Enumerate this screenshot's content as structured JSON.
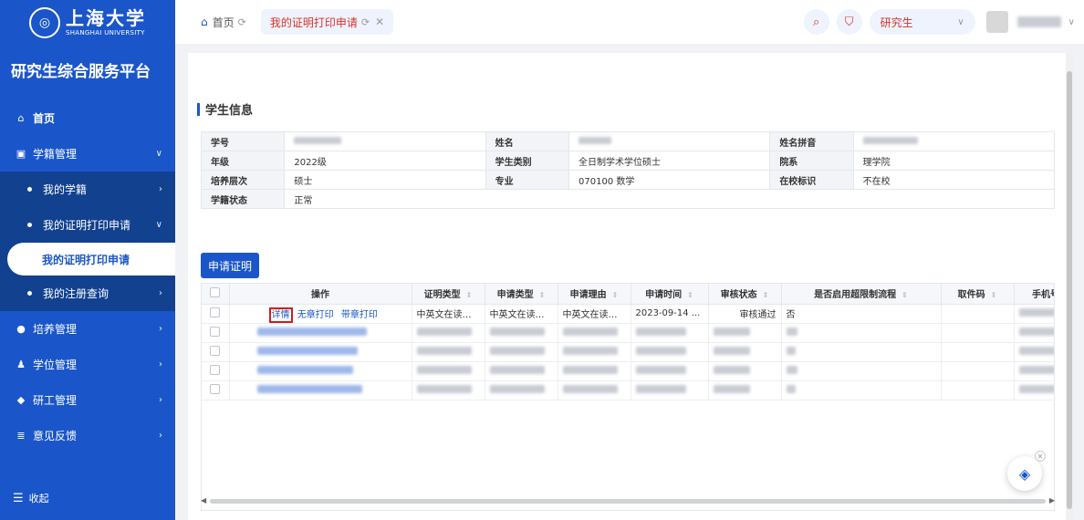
{
  "sidebar": {
    "logo_cn": "上海大学",
    "logo_en": "SHANGHAI UNIVERSITY",
    "platform_title": "研究生综合服务平台",
    "home": "首页",
    "student_status": "学籍管理",
    "my_status": "我的学籍",
    "cert_print": "我的证明打印申请",
    "cert_print_leaf": "我的证明打印申请",
    "registration": "我的注册查询",
    "training": "培养管理",
    "degree": "学位管理",
    "research": "研工管理",
    "feedback": "意见反馈",
    "collapse": "收起"
  },
  "topbar": {
    "home_tab": "首页",
    "active_tab": "我的证明打印申请",
    "role": "研究生"
  },
  "section": {
    "title": "学生信息"
  },
  "info": {
    "labels": {
      "student_no": "学号",
      "name": "姓名",
      "pinyin": "姓名拼音",
      "grade": "年级",
      "student_type": "学生类别",
      "department": "院系",
      "level": "培养层次",
      "major": "专业",
      "on_campus": "在校标识",
      "status": "学籍状态"
    },
    "values": {
      "grade": "2022级",
      "student_type": "全日制学术学位硕士",
      "department": "理学院",
      "level": "硕士",
      "major": "070100 数学",
      "on_campus": "不在校",
      "status": "正常"
    }
  },
  "apply_button": "申请证明",
  "table": {
    "headers": {
      "action": "操作",
      "cert_type": "证明类型",
      "apply_type": "申请类型",
      "reason": "申请理由",
      "apply_time": "申请时间",
      "review_status": "审核状态",
      "over_limit": "是否启用超限制流程",
      "pickup_code": "取件码",
      "phone": "手机号"
    },
    "row1": {
      "detail": "详情",
      "print_no_seal": "无章打印",
      "print_seal": "带章打印",
      "cert_type": "中英文在读证...",
      "apply_type": "中英文在读证...",
      "reason": "中英文在读证...",
      "apply_time": "2023-09-14 ...",
      "review_status": "审核通过",
      "over_limit": "否"
    }
  },
  "colors": {
    "primary": "#1a56c9",
    "accent_red": "#d9342b"
  }
}
